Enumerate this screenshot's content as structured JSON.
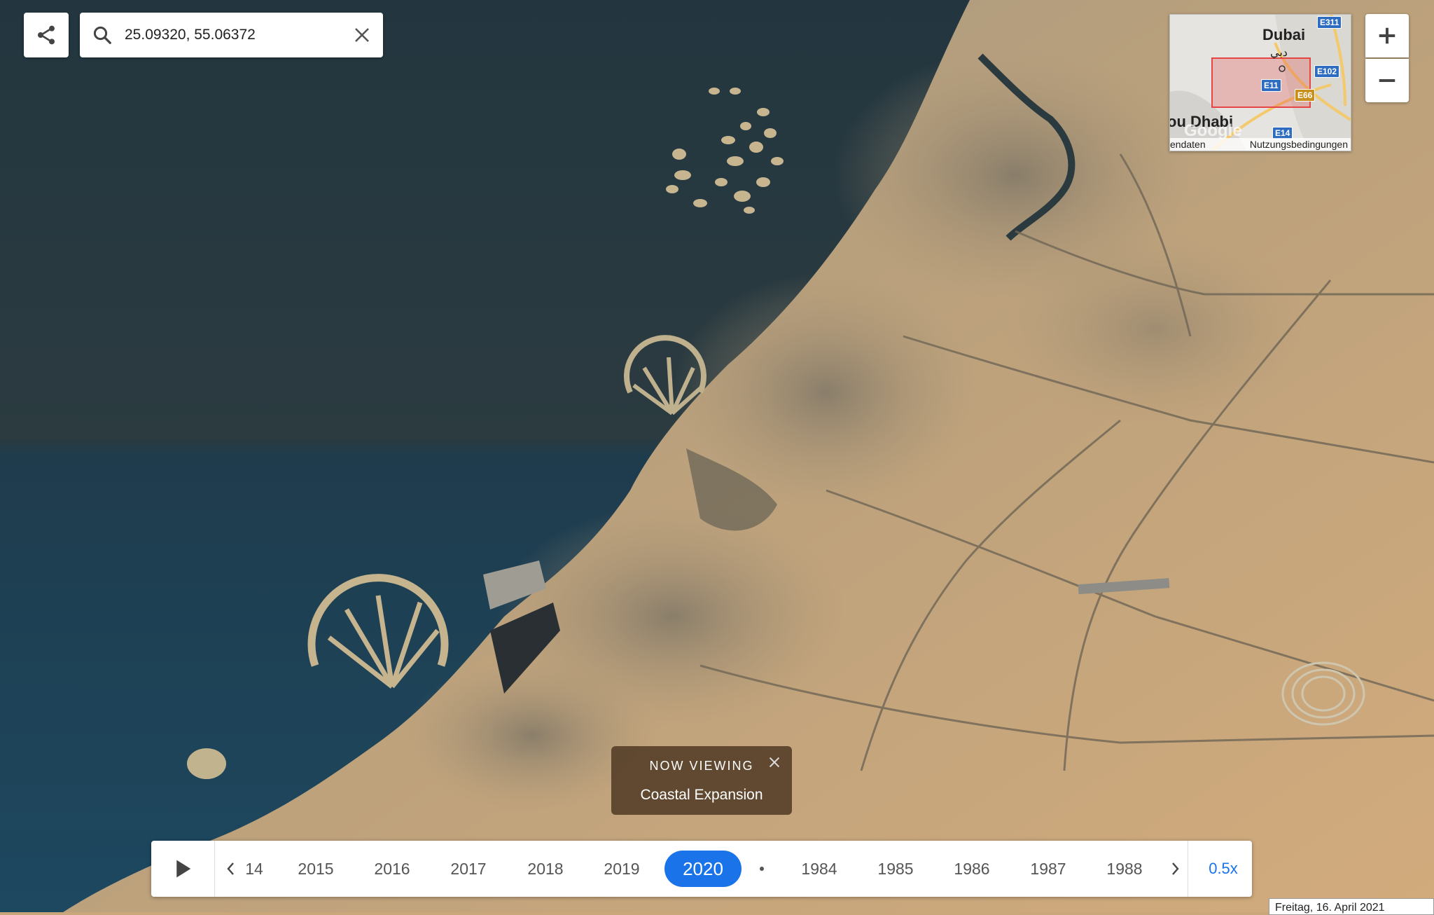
{
  "search": {
    "value": "25.09320, 55.06372"
  },
  "minimap": {
    "city_dubai": "Dubai",
    "city_arabic": "دبي",
    "city_abudhabi": "ou Dhabi",
    "watermark": "Google",
    "footer_left": "endaten",
    "footer_right": "Nutzungsbedingungen",
    "highways": [
      "E311",
      "E102",
      "E11",
      "E66",
      "E14"
    ]
  },
  "toast": {
    "label": "NOW VIEWING",
    "title": "Coastal Expansion"
  },
  "timeline": {
    "years": [
      "14",
      "2015",
      "2016",
      "2017",
      "2018",
      "2019",
      "2020",
      "1984",
      "1985",
      "1986",
      "1987",
      "1988"
    ],
    "active_year": "2020",
    "speed": "0.5x"
  },
  "date": "Freitag, 16. April 2021",
  "colors": {
    "accent": "#1a73e8",
    "sea": "#1f3a47",
    "desert": "#cfa978"
  }
}
